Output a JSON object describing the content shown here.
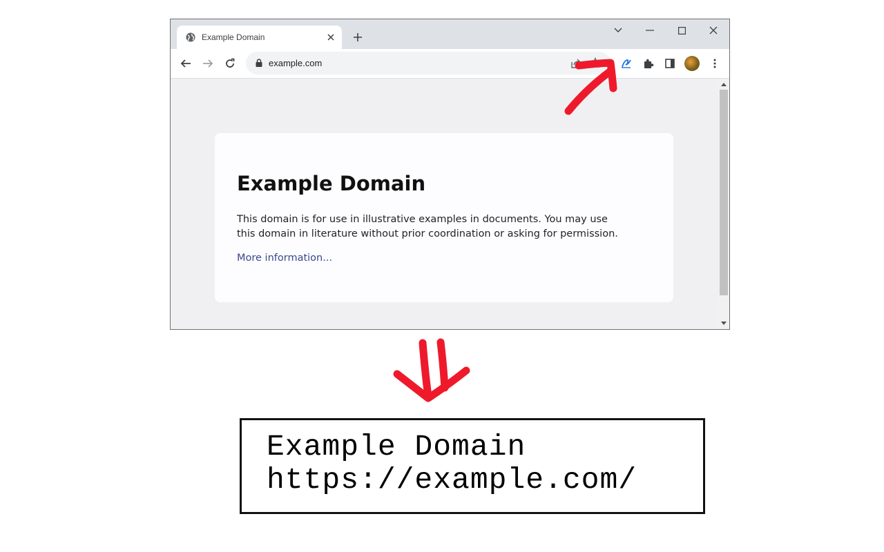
{
  "browser": {
    "tab": {
      "title": "Example Domain",
      "favicon": "globe-icon"
    },
    "toolbar": {
      "url": "example.com"
    },
    "page": {
      "heading": "Example Domain",
      "body": "This domain is for use in illustrative examples in documents. You may use this domain in literature without prior coordination or asking for permission.",
      "link": "More information..."
    }
  },
  "output_box": {
    "line1": "Example Domain",
    "line2": "https://example.com/"
  },
  "colors": {
    "annotation": "#ee1a2b",
    "extension_icon": "#1a73e8",
    "link": "#38488f"
  }
}
